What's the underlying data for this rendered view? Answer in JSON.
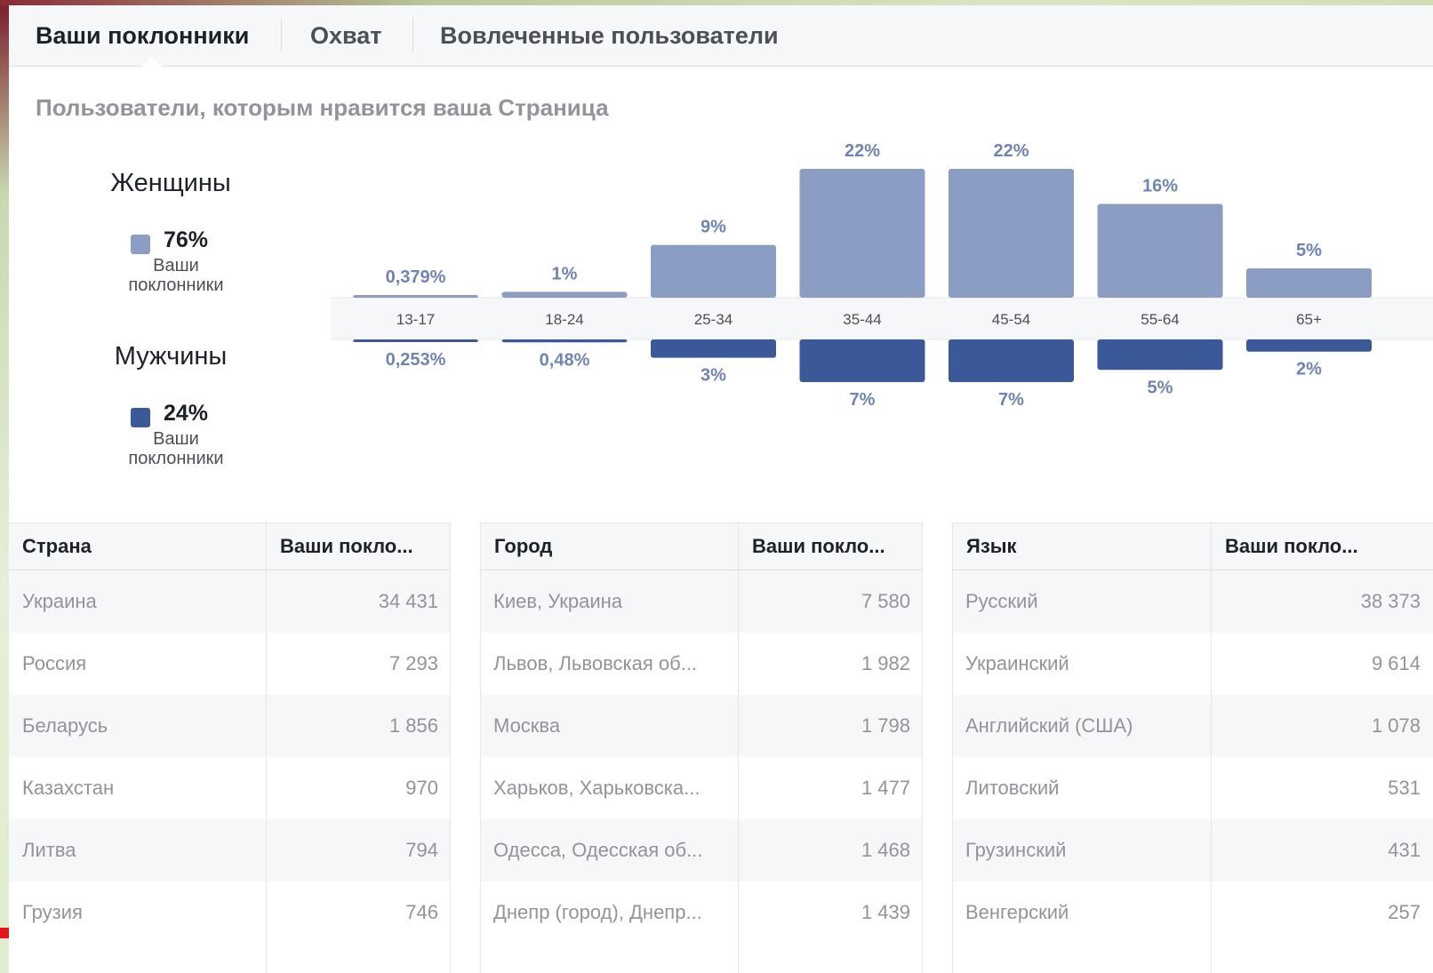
{
  "tabs": [
    {
      "label": "Ваши поклонники",
      "active": true
    },
    {
      "label": "Охват",
      "active": false
    },
    {
      "label": "Вовлеченные пользователи",
      "active": false
    }
  ],
  "section_title": "Пользователи, которым нравится ваша Страница",
  "legend": {
    "women": {
      "title": "Женщины",
      "percent": "76%",
      "sub_line1": "Ваши",
      "sub_line2": "поклонники"
    },
    "men": {
      "title": "Мужчины",
      "percent": "24%",
      "sub_line1": "Ваши",
      "sub_line2": "поклонники"
    }
  },
  "colors": {
    "women": "#8b9dc3",
    "men": "#3b5998",
    "tick_band": "#f6f7f9",
    "label": "#6d84b4"
  },
  "chart_data": {
    "type": "bar",
    "categories": [
      "13-17",
      "18-24",
      "25-34",
      "35-44",
      "45-54",
      "55-64",
      "65+"
    ],
    "series": [
      {
        "name": "Женщины",
        "values": [
          0.379,
          1,
          9,
          22,
          22,
          16,
          5
        ],
        "labels": [
          "0,379%",
          "1%",
          "9%",
          "22%",
          "22%",
          "16%",
          "5%"
        ]
      },
      {
        "name": "Мужчины",
        "values": [
          0.253,
          0.48,
          3,
          7,
          7,
          5,
          2
        ],
        "labels": [
          "0,253%",
          "0,48%",
          "3%",
          "7%",
          "7%",
          "5%",
          "2%"
        ]
      }
    ],
    "ylim": [
      0,
      22
    ],
    "grid": false
  },
  "tables": [
    {
      "col1": "Страна",
      "col2": "Ваши покло...",
      "rows": [
        {
          "name": "Украина",
          "value": "34 431"
        },
        {
          "name": "Россия",
          "value": "7 293"
        },
        {
          "name": "Беларусь",
          "value": "1 856"
        },
        {
          "name": "Казахстан",
          "value": "970"
        },
        {
          "name": "Литва",
          "value": "794"
        },
        {
          "name": "Грузия",
          "value": "746"
        }
      ]
    },
    {
      "col1": "Город",
      "col2": "Ваши покло...",
      "rows": [
        {
          "name": "Киев, Украина",
          "value": "7 580"
        },
        {
          "name": "Львов, Львовская об...",
          "value": "1 982"
        },
        {
          "name": "Москва",
          "value": "1 798"
        },
        {
          "name": "Харьков, Харьковска...",
          "value": "1 477"
        },
        {
          "name": "Одесса, Одесская об...",
          "value": "1 468"
        },
        {
          "name": "Днепр (город), Днепр...",
          "value": "1 439"
        }
      ]
    },
    {
      "col1": "Язык",
      "col2": "Ваши покло...",
      "rows": [
        {
          "name": "Русский",
          "value": "38 373"
        },
        {
          "name": "Украинский",
          "value": "9 614"
        },
        {
          "name": "Английский (США)",
          "value": "1 078"
        },
        {
          "name": "Литовский",
          "value": "531"
        },
        {
          "name": "Грузинский",
          "value": "431"
        },
        {
          "name": "Венгерский",
          "value": "257"
        }
      ]
    }
  ]
}
